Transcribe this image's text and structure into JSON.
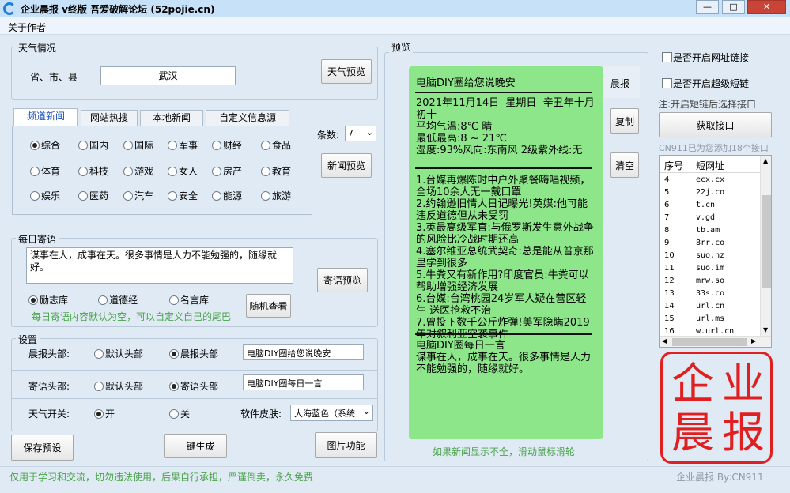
{
  "window": {
    "title": "企业晨报 v终版 吾爱破解论坛 (52pojie.cn)",
    "minimize": "—",
    "maximize": "□",
    "close": "✕"
  },
  "menu": {
    "about": "关于作者"
  },
  "weather": {
    "group_label": "天气情况",
    "location_label": "省、市、县",
    "location_value": "武汉",
    "preview_button": "天气预览"
  },
  "news": {
    "tabs": [
      "频道新闻",
      "网站热搜",
      "本地新闻",
      "自定义信息源"
    ],
    "channels": [
      {
        "label": "综合",
        "checked": true
      },
      {
        "label": "国内",
        "checked": false
      },
      {
        "label": "国际",
        "checked": false
      },
      {
        "label": "军事",
        "checked": false
      },
      {
        "label": "财经",
        "checked": false
      },
      {
        "label": "食品",
        "checked": false
      },
      {
        "label": "体育",
        "checked": false
      },
      {
        "label": "科技",
        "checked": false
      },
      {
        "label": "游戏",
        "checked": false
      },
      {
        "label": "女人",
        "checked": false
      },
      {
        "label": "房产",
        "checked": false
      },
      {
        "label": "教育",
        "checked": false
      },
      {
        "label": "娱乐",
        "checked": false
      },
      {
        "label": "医药",
        "checked": false
      },
      {
        "label": "汽车",
        "checked": false
      },
      {
        "label": "安全",
        "checked": false
      },
      {
        "label": "能源",
        "checked": false
      },
      {
        "label": "旅游",
        "checked": false
      }
    ],
    "count_label": "条数:",
    "count_value": "7",
    "preview_button": "新闻预览"
  },
  "daily_quote": {
    "group_label": "每日寄语",
    "text": "谋事在人，成事在天。很多事情是人力不能勉强的，随缘就好。",
    "preview_button": "寄语预览",
    "sources": [
      {
        "label": "励志库",
        "checked": true
      },
      {
        "label": "道德经",
        "checked": false
      },
      {
        "label": "名言库",
        "checked": false
      }
    ],
    "random_button": "随机查看",
    "hint": "每日寄语内容默认为空，可以自定义自己的尾巴"
  },
  "settings": {
    "group_label": "设置",
    "morning_header_label": "晨报头部:",
    "morning_header_options": [
      {
        "label": "默认头部",
        "checked": false
      },
      {
        "label": "晨报头部",
        "checked": true
      }
    ],
    "morning_header_value": "电脑DIY圈给您说晚安",
    "quote_header_label": "寄语头部:",
    "quote_header_options": [
      {
        "label": "默认头部",
        "checked": false
      },
      {
        "label": "寄语头部",
        "checked": true
      }
    ],
    "quote_header_value": "电脑DIY圈每日一言",
    "weather_switch_label": "天气开关:",
    "weather_switch_options": [
      {
        "label": "开",
        "checked": true
      },
      {
        "label": "关",
        "checked": false
      }
    ],
    "skin_label": "软件皮肤:",
    "skin_value": "大海蓝色（系统"
  },
  "actions": {
    "save_preset": "保存预设",
    "generate": "一键生成",
    "image_function": "图片功能"
  },
  "preview": {
    "group_label": "预览",
    "title": "电脑DIY圈给您说晚安",
    "weather_block": "2021年11月14日  星期日  辛丑年十月初十\n平均气温:8℃ 晴\n最低最高:8 ~ 21℃\n湿度:93%风向:东南风 2级紫外线:无",
    "news_block": "1.台媒再爆陈时中户外聚餐嗨唱视频，全场10余人无一戴口罩\n2.约翰逊旧情人日记曝光!英媒:他可能违反道德但从未受罚\n3.英最高级军官:与俄罗斯发生意外战争的风险比冷战时期还高\n4.塞尔维亚总统武契奇:总是能从普京那里学到很多\n5.牛粪又有新作用?印度官员:牛粪可以帮助增强经济发展\n6.台媒:台湾桃园24岁军人疑在营区轻生 送医抢救不治\n7.曾投下数千公斤炸弹!美军隐瞒2019年对叙利亚空袭事件",
    "quote_title": "电脑DIY圈每日一言",
    "quote_text": "谋事在人，成事在天。很多事情是人力不能勉强的，随缘就好。",
    "side_tag": "晨报",
    "copy_button": "复制",
    "clear_button": "清空",
    "hint": "如果新闻显示不全，滑动鼠标滑轮"
  },
  "links": {
    "enable_url_link": "是否开启网址链接",
    "enable_super_short": "是否开启超级短链",
    "note": "注:开启短链后选择接口",
    "get_api_button": "获取接口",
    "added_note": "CN911已为您添加18个接口",
    "col_no": "序号",
    "col_url": "短网址",
    "rows": [
      {
        "no": "4",
        "url": "ecx.cx"
      },
      {
        "no": "5",
        "url": "22j.co"
      },
      {
        "no": "6",
        "url": "t.cn"
      },
      {
        "no": "7",
        "url": "v.gd"
      },
      {
        "no": "8",
        "url": "tb.am"
      },
      {
        "no": "9",
        "url": "8rr.co"
      },
      {
        "no": "10",
        "url": "suo.nz"
      },
      {
        "no": "11",
        "url": "suo.im"
      },
      {
        "no": "12",
        "url": "mrw.so"
      },
      {
        "no": "13",
        "url": "33s.co"
      },
      {
        "no": "14",
        "url": "url.cn"
      },
      {
        "no": "15",
        "url": "url.ms"
      },
      {
        "no": "16",
        "url": "w.url.cn"
      }
    ]
  },
  "seal": {
    "chars": [
      "企",
      "业",
      "晨",
      "报"
    ]
  },
  "status": {
    "left": "仅用于学习和交流，切勿违法使用，后果自行承担，严谨倒卖，永久免费",
    "right": "企业晨报 By:CN911"
  },
  "colors": {
    "background": "#dfeaf5",
    "preview_bg": "#8ee68a",
    "seal_red": "#e02020",
    "hint_green": "#4aa34a",
    "tab_active_text": "#1a4fb5"
  }
}
